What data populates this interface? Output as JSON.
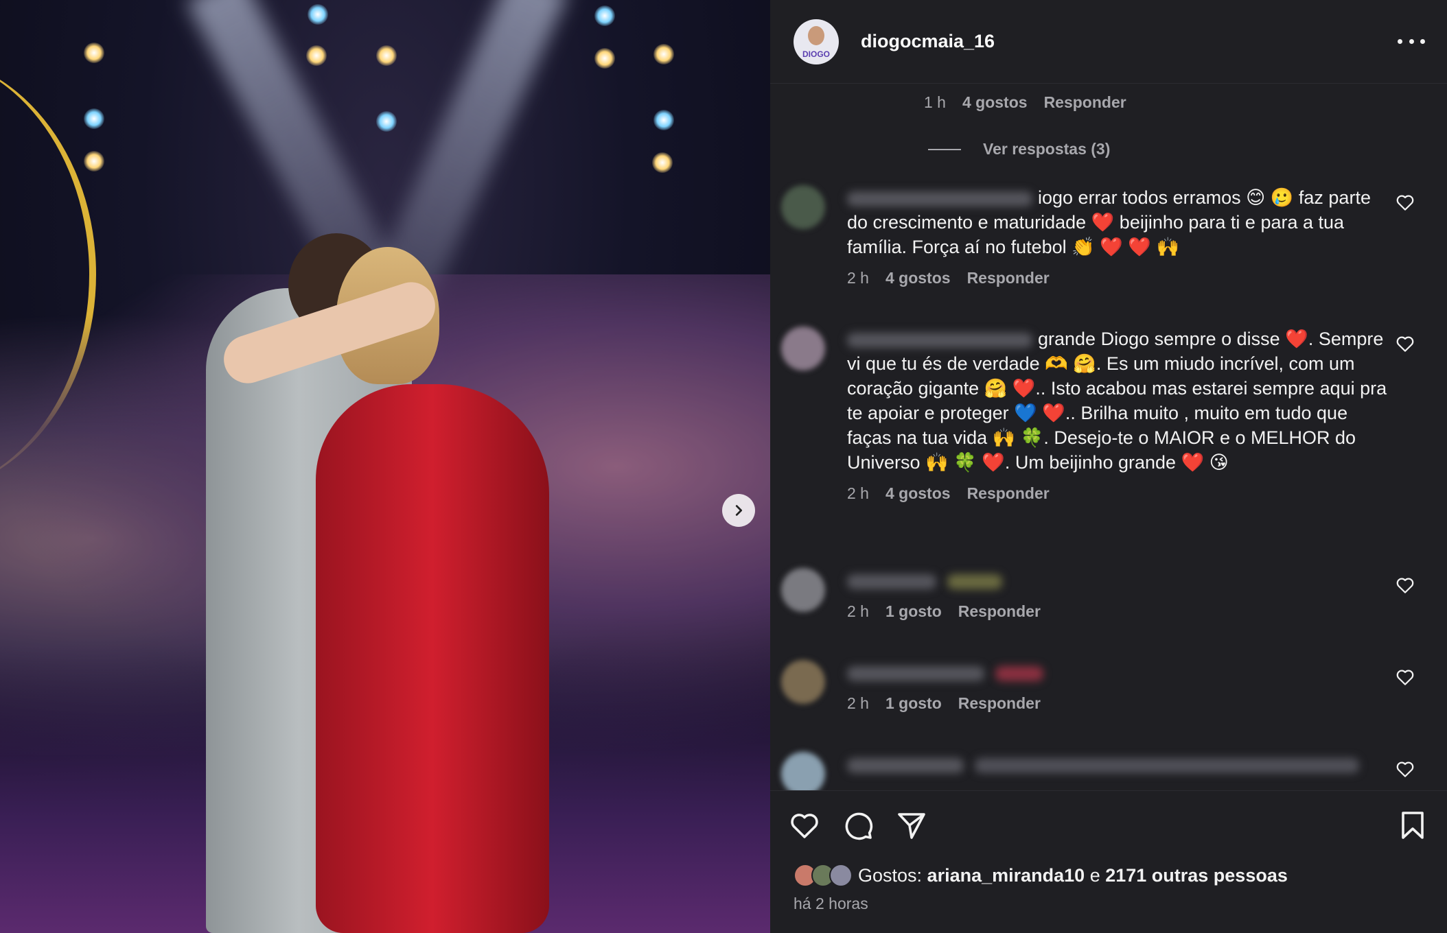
{
  "post": {
    "username": "diogocmaia_16",
    "avatar_tag": "DIOGO",
    "icons": {
      "more": "more-options-icon",
      "next": "chevron-right-icon"
    }
  },
  "thread_top": {
    "time": "1 h",
    "likes": "4 gostos",
    "reply": "Responder",
    "view_replies": "Ver respostas (3)"
  },
  "comments": [
    {
      "text": "iogo errar todos erramos 😊 🥲 faz parte do crescimento e maturidade ❤️ beijinho para ti e para a tua família. Força aí no futebol 👏 ❤️ ❤️ 🙌",
      "time": "2 h",
      "likes": "4 gostos",
      "reply": "Responder"
    },
    {
      "text": "grande Diogo sempre o disse ❤️. Sempre vi que tu és de verdade 🫶 🤗. Es um miudo incrível, com um coração gigante 🤗 ❤️.. Isto acabou mas estarei sempre aqui pra te apoiar e proteger 💙 ❤️.. Brilha muito , muito em tudo que faças na tua vida 🙌 🍀. Desejo-te o MAIOR e o MELHOR do Universo 🙌 🍀 ❤️. Um beijinho grande ❤️ 😘",
      "time": "2 h",
      "likes": "4 gostos",
      "reply": "Responder"
    },
    {
      "text": "",
      "time": "2 h",
      "likes": "1 gosto",
      "reply": "Responder"
    },
    {
      "text": "",
      "time": "2 h",
      "likes": "1 gosto",
      "reply": "Responder"
    },
    {
      "text": "",
      "time": "",
      "likes": "",
      "reply": ""
    }
  ],
  "likes_summary": {
    "prefix": "Gostos: ",
    "user": "ariana_miranda10",
    "joiner": " e ",
    "others": "2171 outras pessoas"
  },
  "posted_ago": "há 2 horas",
  "colors": {
    "sidebar_bg": "#1f1f23",
    "muted_text": "#a8a8ad",
    "heart_red": "#ff3040"
  }
}
